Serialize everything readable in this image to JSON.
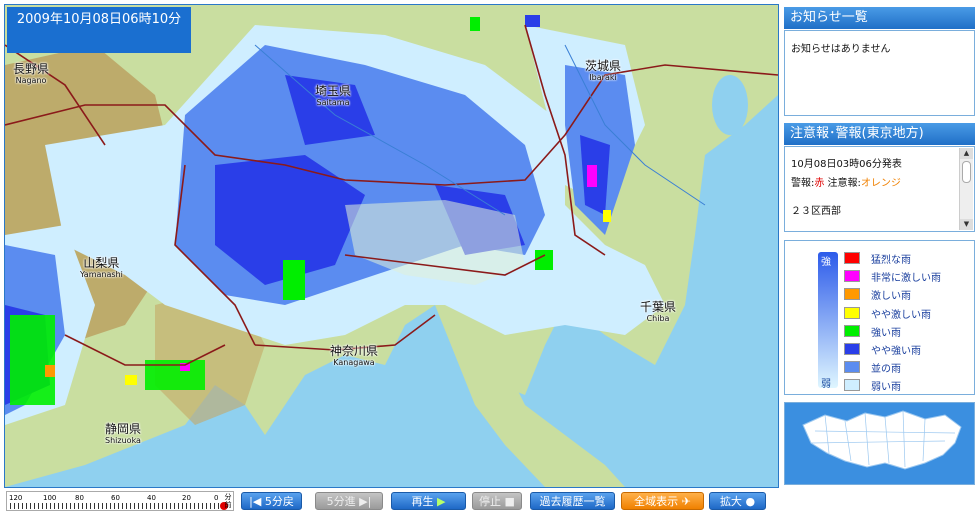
{
  "timestamp": "2009年10月08日06時10分",
  "prefectures": [
    {
      "id": "nagano",
      "jp": "長野県",
      "en": "Nagano"
    },
    {
      "id": "saitama",
      "jp": "埼玉県",
      "en": "Saitama"
    },
    {
      "id": "ibaraki",
      "jp": "茨城県",
      "en": "Ibaraki"
    },
    {
      "id": "yamanashi",
      "jp": "山梨県",
      "en": "Yamanashi"
    },
    {
      "id": "chiba",
      "jp": "千葉県",
      "en": "Chiba"
    },
    {
      "id": "kanagawa",
      "jp": "神奈川県",
      "en": "Kanagawa"
    },
    {
      "id": "shizuoka",
      "jp": "静岡県",
      "en": "Shizuoka"
    }
  ],
  "notice": {
    "title": "お知らせ一覧",
    "text": "お知らせはありません"
  },
  "warnings": {
    "title": "注意報･警報(東京地方)",
    "issued": "10月08日03時06分発表",
    "legend_prefix1": "警報:",
    "legend_red": "赤",
    "legend_prefix2": " 注意報:",
    "legend_orange": "オレンジ",
    "area": "２３区西部"
  },
  "legend": {
    "strong_label": "強",
    "weak_label": "弱",
    "items": [
      {
        "label": "猛烈な雨",
        "color": "#ff0000"
      },
      {
        "label": "非常に激しい雨",
        "color": "#ff00ff"
      },
      {
        "label": "激しい雨",
        "color": "#ff9900"
      },
      {
        "label": "やや激しい雨",
        "color": "#ffff00"
      },
      {
        "label": "強い雨",
        "color": "#00ee00"
      },
      {
        "label": "やや強い雨",
        "color": "#2a3ee8"
      },
      {
        "label": "並の雨",
        "color": "#5b8cf0"
      },
      {
        "label": "弱い雨",
        "color": "#cfeeff"
      }
    ]
  },
  "time_scale": {
    "ticks": [
      "120",
      "100",
      "80",
      "60",
      "40",
      "20",
      "0"
    ],
    "unit": "分前"
  },
  "toolbar": {
    "back": "5分戻",
    "forward": "5分進",
    "play": "再生",
    "stop": "停止",
    "history": "過去履歴一覧",
    "full_view": "全域表示",
    "zoom": "拡大"
  }
}
